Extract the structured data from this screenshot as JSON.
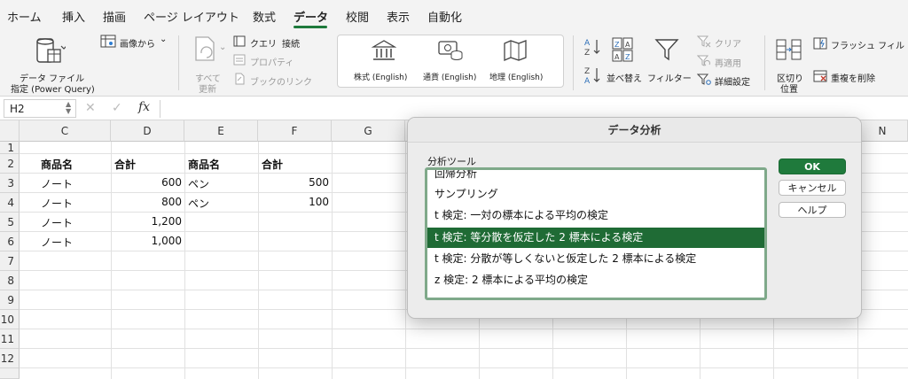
{
  "tabs": [
    {
      "label": "ホーム"
    },
    {
      "label": "挿入"
    },
    {
      "label": "描画"
    },
    {
      "label": "ページ レイアウト"
    },
    {
      "label": "数式"
    },
    {
      "label": "データ"
    },
    {
      "label": "校閲"
    },
    {
      "label": "表示"
    },
    {
      "label": "自動化"
    }
  ],
  "ribbon": {
    "get_data_line1": "データ ファイル",
    "get_data_line2": "指定 (Power Query)",
    "from_picture": "画像から",
    "refresh_all_line1": "すべて",
    "refresh_all_line2": "更新",
    "queries": "クエリ",
    "connections": "接続",
    "properties": "プロパティ",
    "edit_links": "ブックのリンク",
    "stocks": "株式 (English)",
    "currencies": "通貨 (English)",
    "geography": "地理 (English)",
    "sort": "並べ替え",
    "filter": "フィルター",
    "clear": "クリア",
    "reapply": "再適用",
    "advanced": "詳細設定",
    "text_to_columns_line1": "区切り",
    "text_to_columns_line2": "位置",
    "flash_fill": "フラッシュ フィル",
    "remove_duplicates": "重複を削除"
  },
  "formula_bar": {
    "name_box": "H2",
    "fx": "fx"
  },
  "grid": {
    "columns": [
      "C",
      "D",
      "E",
      "F",
      "G",
      "N"
    ],
    "rows": [
      "1",
      "2",
      "3",
      "4",
      "5",
      "6",
      "7",
      "8",
      "9",
      "10",
      "11",
      "12"
    ],
    "cells": {
      "C2": "商品名",
      "D2": "合計",
      "E2": "商品名",
      "F2": "合計",
      "C3": "ノート",
      "D3": "600",
      "E3": "ペン",
      "F3": "500",
      "C4": "ノート",
      "D4": "800",
      "E4": "ペン",
      "F4": "100",
      "C5": "ノート",
      "D5": "1,200",
      "C6": "ノート",
      "D6": "1,000"
    }
  },
  "dialog": {
    "title": "データ分析",
    "list_label": "分析ツール",
    "items": [
      "回帰分析",
      "サンプリング",
      "t 検定:  一対の標本による平均の検定",
      "t 検定:  等分散を仮定した 2 標本による検定",
      "t 検定:  分散が等しくないと仮定した 2 標本による検定",
      "z 検定:  2 標本による平均の検定"
    ],
    "ok": "OK",
    "cancel": "キャンセル",
    "help": "ヘルプ"
  },
  "colors": {
    "accent": "#1f7a3c",
    "selection": "#1f6b35",
    "list_border": "#7fa98a"
  }
}
